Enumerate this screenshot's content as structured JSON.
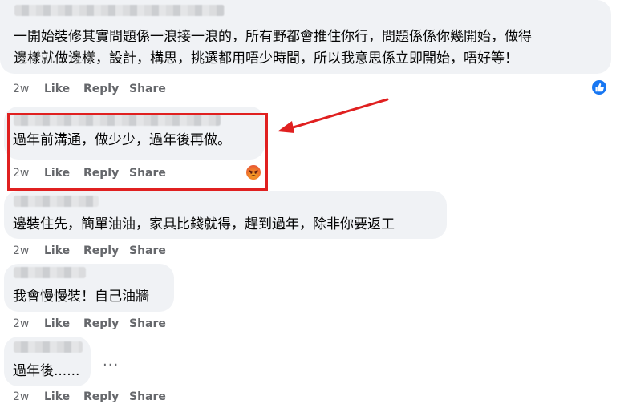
{
  "comments": [
    {
      "text_lines": [
        "一開始裝修其實問題係一浪接一浪的，所有野都會推住你行，問題係係你幾開始，做得",
        "邊樣就做邊樣，設計，構思，挑選都用唔少時間，所以我意思係立即開始，唔好等！"
      ],
      "time": "2w",
      "like": "Like",
      "reply": "Reply",
      "share": "Share",
      "reaction": "like-reaction"
    },
    {
      "text_lines": [
        "過年前溝通，做少少，過年後再做。"
      ],
      "time": "2w",
      "like": "Like",
      "reply": "Reply",
      "share": "Share",
      "reaction": "angry-reaction"
    },
    {
      "text_lines": [
        "邊裝住先，簡單油油，家具比錢就得，趕到過年，除非你要返工"
      ],
      "time": "2w",
      "like": "Like",
      "reply": "Reply",
      "share": "Share"
    },
    {
      "text_lines": [
        "我會慢慢裝！自己油牆"
      ],
      "time": "2w",
      "like": "Like",
      "reply": "Reply",
      "share": "Share"
    },
    {
      "text_lines": [
        "過年後......"
      ],
      "time": "2w",
      "like": "Like",
      "reply": "Reply",
      "share": "Share",
      "more": "..."
    }
  ],
  "colors": {
    "bubble": "#f0f2f5",
    "action_text": "#65676b",
    "highlight": "#e02020",
    "like_blue": "#1877f2"
  },
  "annotation": {
    "type": "red-box-with-arrow",
    "target_comment": 2
  }
}
